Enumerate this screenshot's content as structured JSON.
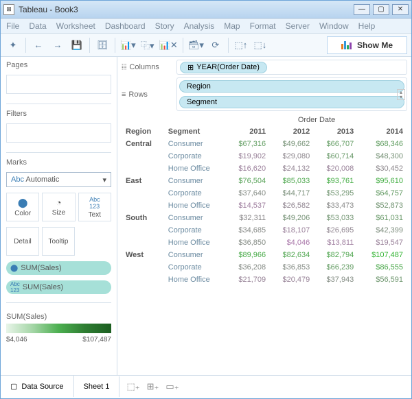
{
  "window": {
    "title": "Tableau - Book3"
  },
  "menu": [
    "File",
    "Data",
    "Worksheet",
    "Dashboard",
    "Story",
    "Analysis",
    "Map",
    "Format",
    "Server",
    "Window",
    "Help"
  ],
  "showme": "Show Me",
  "sidebar": {
    "pages": "Pages",
    "filters": "Filters",
    "marks": "Marks",
    "marksType": "Automatic",
    "markBtns": [
      "Color",
      "Size",
      "Text",
      "Detail",
      "Tooltip"
    ],
    "pills": [
      "SUM(Sales)",
      "SUM(Sales)"
    ],
    "legendTitle": "SUM(Sales)",
    "legendMin": "$4,046",
    "legendMax": "$107,487"
  },
  "shelves": {
    "columnsLabel": "Columns",
    "rowsLabel": "Rows",
    "columnPill": "YEAR(Order Date)",
    "rowPills": [
      "Region",
      "Segment"
    ]
  },
  "table": {
    "superHeader": "Order Date",
    "headers": [
      "Region",
      "Segment",
      "2011",
      "2012",
      "2013",
      "2014"
    ]
  },
  "chart_data": {
    "type": "table",
    "title": "Sales by Region, Segment, Year",
    "col_dimension": "Order Date (Year)",
    "row_dimensions": [
      "Region",
      "Segment"
    ],
    "measure": "SUM(Sales)",
    "years": [
      "2011",
      "2012",
      "2013",
      "2014"
    ],
    "regions": [
      "Central",
      "East",
      "South",
      "West"
    ],
    "segments": [
      "Consumer",
      "Corporate",
      "Home Office"
    ],
    "color_scale": {
      "min": 4046,
      "max": 107487,
      "palette": "green_sequential"
    },
    "data": [
      {
        "region": "Central",
        "segment": "Consumer",
        "values": [
          67316,
          49662,
          66707,
          68346
        ]
      },
      {
        "region": "Central",
        "segment": "Corporate",
        "values": [
          19902,
          29080,
          60714,
          48300
        ]
      },
      {
        "region": "Central",
        "segment": "Home Office",
        "values": [
          16620,
          24132,
          20008,
          30452
        ]
      },
      {
        "region": "East",
        "segment": "Consumer",
        "values": [
          76504,
          85033,
          93761,
          95610
        ]
      },
      {
        "region": "East",
        "segment": "Corporate",
        "values": [
          37640,
          44717,
          53295,
          64757
        ]
      },
      {
        "region": "East",
        "segment": "Home Office",
        "values": [
          14537,
          26582,
          33473,
          52873
        ]
      },
      {
        "region": "South",
        "segment": "Consumer",
        "values": [
          32311,
          49206,
          53033,
          61031
        ]
      },
      {
        "region": "South",
        "segment": "Corporate",
        "values": [
          34685,
          18107,
          26695,
          42399
        ]
      },
      {
        "region": "South",
        "segment": "Home Office",
        "values": [
          36850,
          4046,
          13811,
          19547
        ]
      },
      {
        "region": "West",
        "segment": "Consumer",
        "values": [
          89966,
          82634,
          82794,
          107487
        ]
      },
      {
        "region": "West",
        "segment": "Corporate",
        "values": [
          36208,
          36853,
          66239,
          86555
        ]
      },
      {
        "region": "West",
        "segment": "Home Office",
        "values": [
          21709,
          20479,
          37943,
          56591
        ]
      }
    ]
  },
  "footer": {
    "dataSource": "Data Source",
    "sheet": "Sheet 1"
  }
}
